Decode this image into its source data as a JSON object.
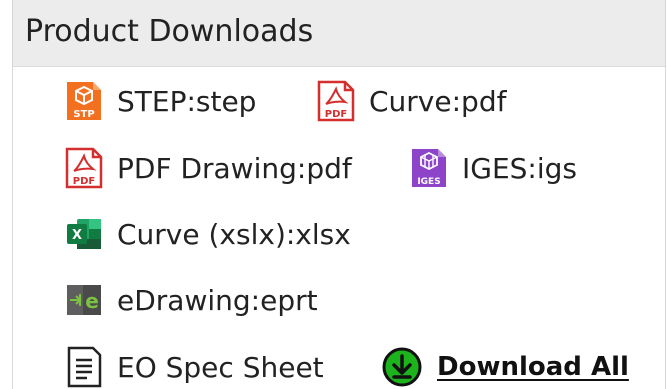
{
  "header": {
    "title": "Product Downloads"
  },
  "downloads": [
    {
      "label": "STEP:step",
      "icon": "step-file-icon",
      "icon_text": "STP",
      "color": "#f37021"
    },
    {
      "label": "Curve:pdf",
      "icon": "pdf-file-icon",
      "icon_text": "PDF",
      "color": "#d32f2f"
    },
    {
      "label": "PDF Drawing:pdf",
      "icon": "pdf-file-icon",
      "icon_text": "PDF",
      "color": "#d32f2f"
    },
    {
      "label": "IGES:igs",
      "icon": "iges-file-icon",
      "icon_text": "IGES",
      "color": "#8e44c9"
    },
    {
      "label": "Curve (xslx):xlsx",
      "icon": "excel-file-icon",
      "icon_text": "X",
      "color": "#1e8e4e"
    },
    {
      "label": "eDrawing:eprt",
      "icon": "edrawing-file-icon",
      "icon_text": "e",
      "color": "#6aa84f"
    },
    {
      "label": "EO Spec Sheet",
      "icon": "document-icon",
      "color": "#222222"
    }
  ],
  "download_all": {
    "label": "Download All",
    "icon": "download-circle-icon",
    "color": "#1db31d"
  }
}
